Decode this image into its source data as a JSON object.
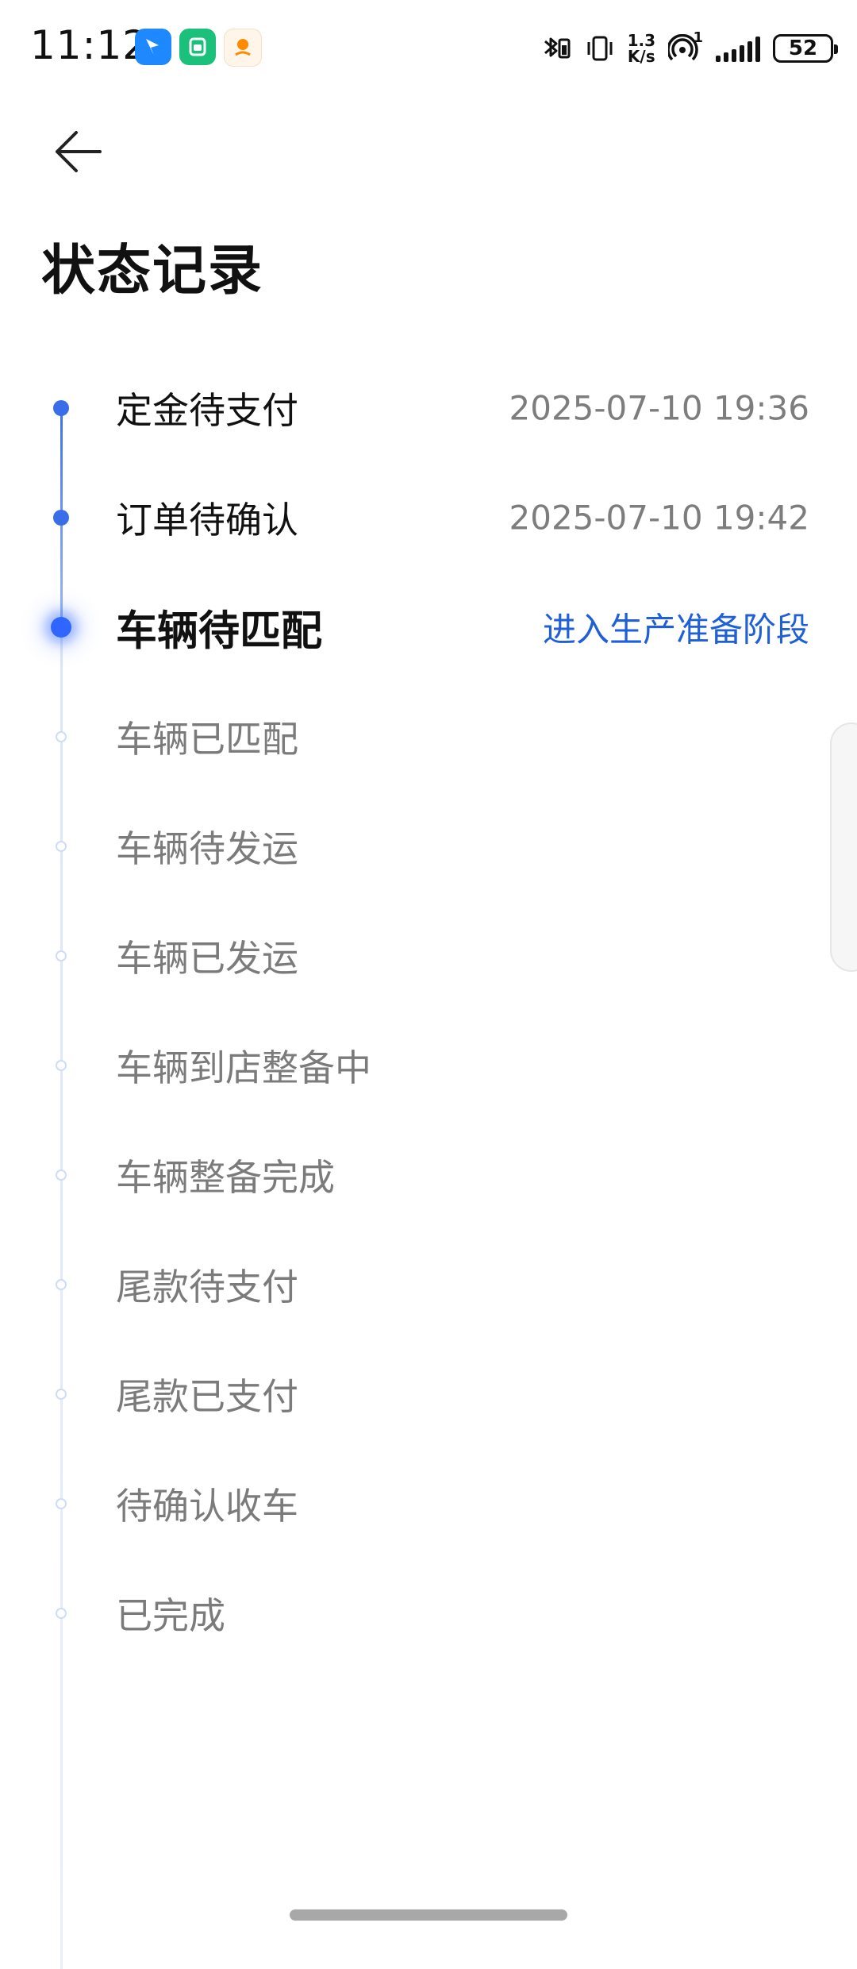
{
  "status_bar": {
    "time": "11:12",
    "apps": [
      "blue-app-icon",
      "green-app-icon",
      "orange-app-icon"
    ],
    "net_speed_value": "1.3",
    "net_speed_unit": "K/s",
    "hotspot_count": "1",
    "battery": "52"
  },
  "header": {
    "back_icon": "back-arrow-icon",
    "title": "状态记录"
  },
  "timeline": [
    {
      "label": "定金待支付",
      "time": "2025-07-10 19:36",
      "state": "done"
    },
    {
      "label": "订单待确认",
      "time": "2025-07-10 19:42",
      "state": "done"
    },
    {
      "label": "车辆待匹配",
      "link": "进入生产准备阶段",
      "state": "current"
    },
    {
      "label": "车辆已匹配",
      "state": "future"
    },
    {
      "label": "车辆待发运",
      "state": "future"
    },
    {
      "label": "车辆已发运",
      "state": "future"
    },
    {
      "label": "车辆到店整备中",
      "state": "future"
    },
    {
      "label": "车辆整备完成",
      "state": "future"
    },
    {
      "label": "尾款待支付",
      "state": "future"
    },
    {
      "label": "尾款已支付",
      "state": "future"
    },
    {
      "label": "待确认收车",
      "state": "future"
    },
    {
      "label": "已完成",
      "state": "future"
    }
  ],
  "colors": {
    "accent": "#2f66ff",
    "link": "#1f5fd8",
    "muted_text": "#7b7b7b"
  }
}
